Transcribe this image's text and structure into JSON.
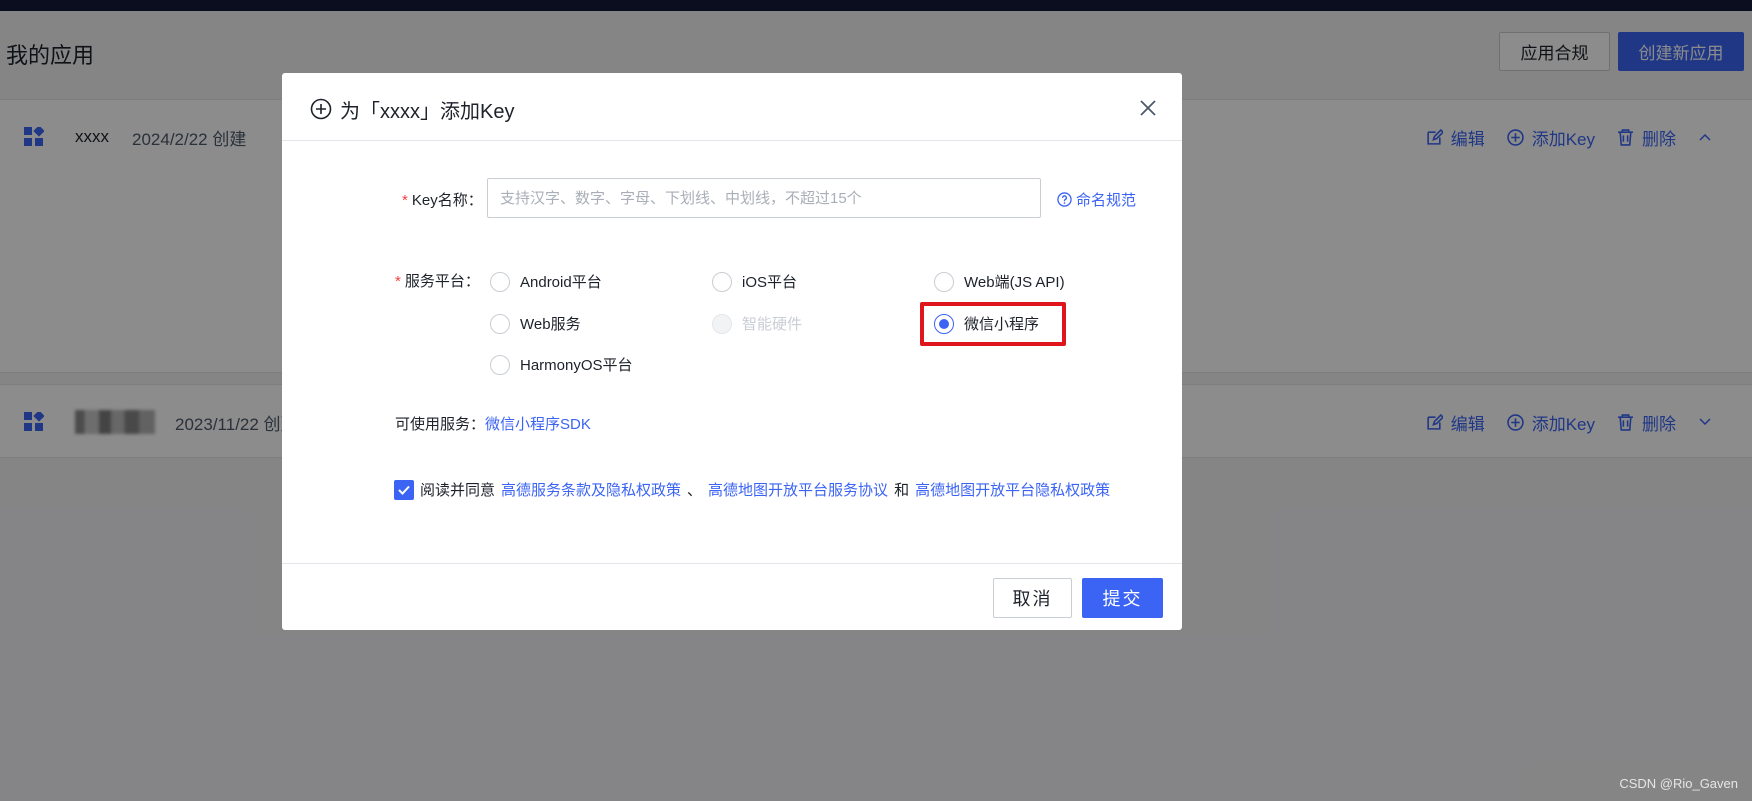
{
  "page": {
    "title": "我的应用",
    "compliance_button": "应用合规",
    "create_button": "创建新应用",
    "watermark": "CSDN @Rio_Gaven"
  },
  "apps": [
    {
      "name": "xxxx",
      "created": "2024/2/22 创建",
      "expanded": true
    },
    {
      "name": "",
      "created": "2023/11/22 创建",
      "expanded": false
    }
  ],
  "app_actions": {
    "edit": "编辑",
    "add_key": "添加Key",
    "delete": "删除"
  },
  "modal": {
    "title": "为「xxxx」添加Key",
    "key_name_label": "Key名称：",
    "key_name_placeholder": "支持汉字、数字、字母、下划线、中划线，不超过15个",
    "key_name_value": "",
    "naming_rule_link": "命名规范",
    "platform_label": "服务平台：",
    "platforms": [
      {
        "label": "Android平台",
        "checked": false,
        "disabled": false
      },
      {
        "label": "iOS平台",
        "checked": false,
        "disabled": false
      },
      {
        "label": "Web端(JS API)",
        "checked": false,
        "disabled": false
      },
      {
        "label": "Web服务",
        "checked": false,
        "disabled": false
      },
      {
        "label": "智能硬件",
        "checked": false,
        "disabled": true
      },
      {
        "label": "微信小程序",
        "checked": true,
        "disabled": false
      },
      {
        "label": "HarmonyOS平台",
        "checked": false,
        "disabled": false
      }
    ],
    "services_label": "可使用服务：",
    "services_value": "微信小程序SDK",
    "agree_text": "阅读并同意",
    "agree_link_1": "高德服务条款及隐私权政策",
    "agree_sep_1": "、",
    "agree_link_2": "高德地图开放平台服务协议",
    "agree_sep_2": "和",
    "agree_link_3": "高德地图开放平台隐私权政策",
    "agree_checked": true,
    "cancel_button": "取消",
    "submit_button": "提交"
  },
  "colors": {
    "primary": "#3b64f5",
    "required": "#f53f3f",
    "highlight": "#e0161d",
    "topbar": "#141a3a"
  }
}
